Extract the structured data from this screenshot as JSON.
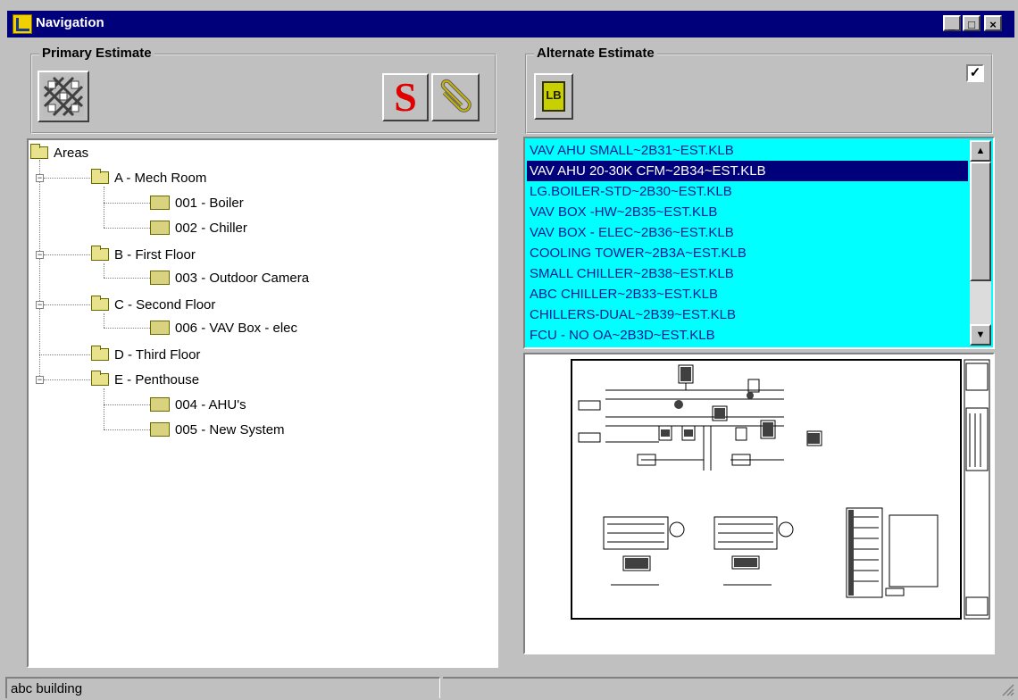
{
  "window": {
    "title": "Navigation",
    "minimize_glyph": "_",
    "maximize_glyph": "□",
    "close_glyph": "×"
  },
  "primary": {
    "label": "Primary Estimate",
    "s_button_glyph": "S"
  },
  "alternate": {
    "label": "Alternate Estimate",
    "checkbox_checked": true,
    "checkbox_glyph": "✓",
    "lb_glyph": "LB"
  },
  "tree": {
    "root": "Areas",
    "nodes": [
      {
        "label": "A - Mech Room"
      },
      {
        "label": "001 - Boiler"
      },
      {
        "label": "002 - Chiller"
      },
      {
        "label": "B - First Floor"
      },
      {
        "label": "003 - Outdoor Camera"
      },
      {
        "label": "C - Second Floor"
      },
      {
        "label": "006 - VAV Box - elec"
      },
      {
        "label": "D - Third Floor"
      },
      {
        "label": "E - Penthouse"
      },
      {
        "label": "004 - AHU's"
      },
      {
        "label": "005 - New System"
      }
    ]
  },
  "files": {
    "items": [
      "VAV AHU SMALL~2B31~EST.KLB",
      "VAV AHU 20-30K CFM~2B34~EST.KLB",
      "LG.BOILER-STD~2B30~EST.KLB",
      "VAV BOX -HW~2B35~EST.KLB",
      "VAV BOX - ELEC~2B36~EST.KLB",
      "COOLING TOWER~2B3A~EST.KLB",
      "SMALL CHILLER~2B38~EST.KLB",
      "ABC CHILLER~2B33~EST.KLB",
      "CHILLERS-DUAL~2B39~EST.KLB",
      "FCU - NO OA~2B3D~EST.KLB"
    ],
    "selected_index": 1,
    "scroll_up_glyph": "▲",
    "scroll_down_glyph": "▼"
  },
  "status": {
    "text": "abc building"
  },
  "colors": {
    "titlebar": "#00007b",
    "list_background": "#00ffff",
    "selection": "#00007b",
    "window": "#c0c0c0"
  }
}
